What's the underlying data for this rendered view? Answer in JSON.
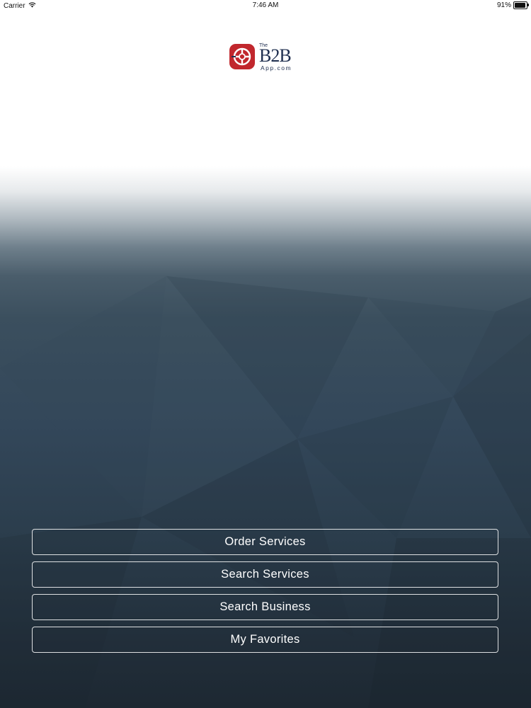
{
  "status_bar": {
    "carrier": "Carrier",
    "time": "7:46 AM",
    "battery_percent": "91%",
    "battery_level": 0.91,
    "wifi_icon": "wifi-icon",
    "battery_icon": "battery-icon"
  },
  "logo": {
    "the": "The",
    "b2b": "B2B",
    "app": "App.com",
    "emblem_icon": "b2b-emblem-icon",
    "brand_red": "#c1272d",
    "brand_navy": "#1f2f4f"
  },
  "menu": {
    "items": [
      {
        "label": "Order Services"
      },
      {
        "label": "Search Services"
      },
      {
        "label": "Search Business"
      },
      {
        "label": "My Favorites"
      }
    ]
  }
}
